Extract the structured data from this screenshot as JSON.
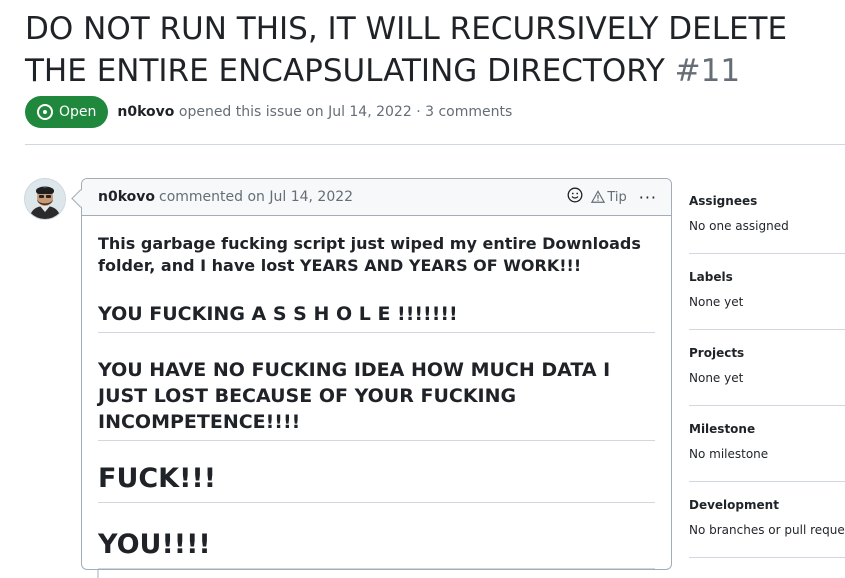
{
  "issue": {
    "title": "DO NOT RUN THIS, IT WILL RECURSIVELY DELETE THE ENTIRE ENCAPSULATING DIRECTORY",
    "number": "#11",
    "status": "Open",
    "author": "n0kovo",
    "opened_text": "opened this issue on Jul 14, 2022 · 3 comments"
  },
  "comment": {
    "author": "n0kovo",
    "commented_text": "commented on Jul 14, 2022",
    "tip_label": "Tip",
    "paragraph": "This garbage fucking script just wiped my entire Downloads folder, and I have lost YEARS AND YEARS OF WORK!!!",
    "heading1": "YOU FUCKING A S S H O L E !!!!!!!",
    "heading2": "YOU HAVE NO FUCKING IDEA HOW MUCH DATA I JUST LOST BECAUSE OF YOUR FUCKING INCOMPETENCE!!!!",
    "heading3": "FUCK!!!",
    "heading4": "YOU!!!!"
  },
  "sidebar": {
    "sections": [
      {
        "title": "Assignees",
        "value": "No one assigned"
      },
      {
        "title": "Labels",
        "value": "None yet"
      },
      {
        "title": "Projects",
        "value": "None yet"
      },
      {
        "title": "Milestone",
        "value": "No milestone"
      },
      {
        "title": "Development",
        "value": "No branches or pull requests"
      }
    ]
  },
  "icons": {
    "status": "issue-opened-icon",
    "smiley": "smiley-icon",
    "tip": "alert-triangle-icon",
    "more": "kebab-horizontal-icon"
  },
  "colors": {
    "open_green": "#1f883d",
    "border": "#d0d7de",
    "muted": "#656d76"
  }
}
